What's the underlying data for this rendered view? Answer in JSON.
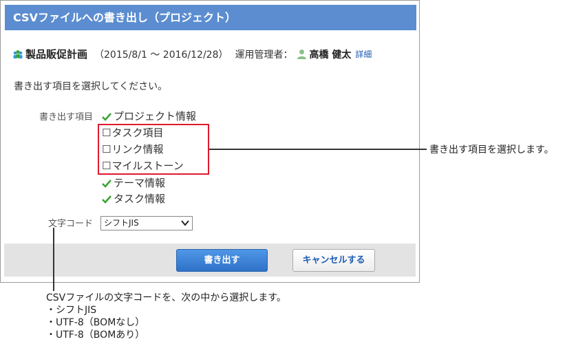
{
  "dialog": {
    "title": "CSVファイルへの書き出し（プロジェクト）",
    "project": {
      "name": "製品販促計画",
      "period": "（2015/8/1 ～ 2016/12/28）",
      "manager_label": "運用管理者：",
      "manager_name": "高橋 健太",
      "detail_link": "詳細"
    },
    "instruction": "書き出す項目を選択してください。",
    "items_label": "書き出す項目",
    "items": [
      {
        "label": "プロジェクト情報",
        "state": "fixed-checked"
      },
      {
        "label": "タスク項目",
        "state": "unchecked"
      },
      {
        "label": "リンク情報",
        "state": "unchecked"
      },
      {
        "label": "マイルストーン",
        "state": "unchecked"
      },
      {
        "label": "テーマ情報",
        "state": "fixed-checked"
      },
      {
        "label": "タスク情報",
        "state": "fixed-checked"
      }
    ],
    "charcode_label": "文字コード",
    "charcode_selected": "シフトJIS",
    "export_button": "書き出す",
    "cancel_button": "キャンセルする"
  },
  "annotations": {
    "right_callout": "書き出す項目を選択します。",
    "bottom_callout": [
      "CSVファイルの文字コードを、次の中から選択します。",
      "・シフトJIS",
      "・UTF-8（BOMなし）",
      "・UTF-8（BOMあり）"
    ]
  },
  "colors": {
    "title_bar": "#5b8dd0",
    "primary_button": "#2f72c9",
    "highlight_border": "#e0182d",
    "check_mark": "#3aa334"
  }
}
